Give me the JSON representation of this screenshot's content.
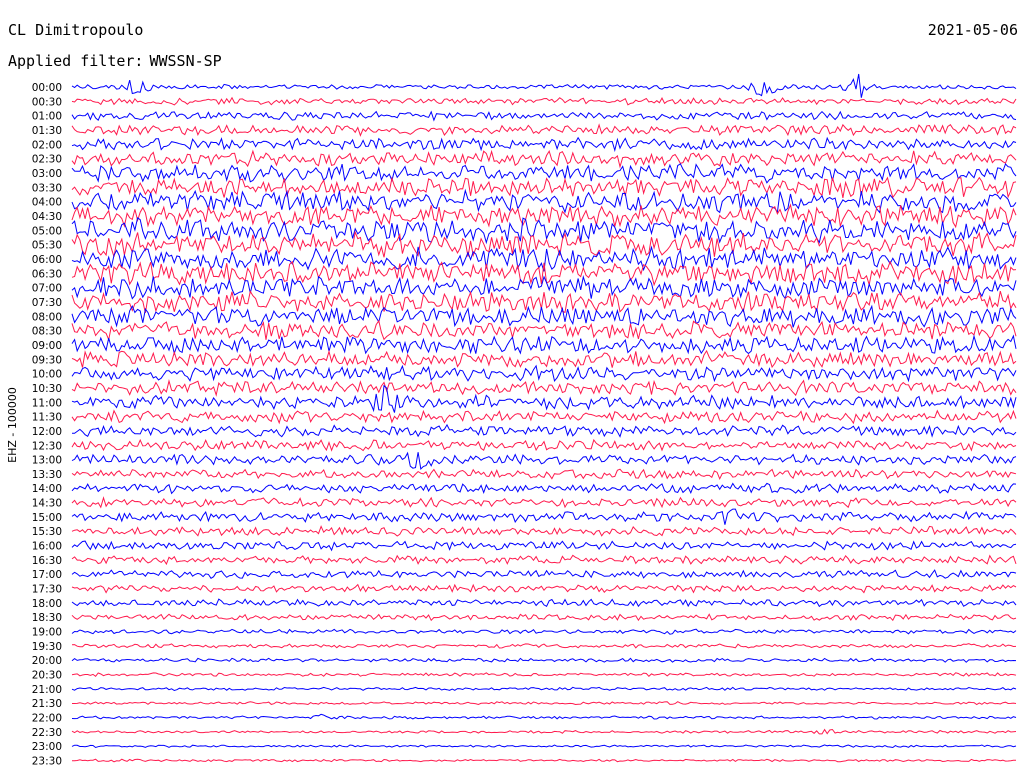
{
  "header": {
    "station": "CL Dimitropoulo",
    "filter_label": "Applied filter:",
    "filter_value": "WWSSN-SP",
    "date": "2021-05-06"
  },
  "chart_data": {
    "type": "line",
    "ylabel": "EHZ - 100000",
    "row_interval_minutes": 30,
    "row_labels": [
      "00:00",
      "00:30",
      "01:00",
      "01:30",
      "02:00",
      "02:30",
      "03:00",
      "03:30",
      "04:00",
      "04:30",
      "05:00",
      "05:30",
      "06:00",
      "06:30",
      "07:00",
      "07:30",
      "08:00",
      "08:30",
      "09:00",
      "09:30",
      "10:00",
      "10:30",
      "11:00",
      "11:30",
      "12:00",
      "12:30",
      "13:00",
      "13:30",
      "14:00",
      "14:30",
      "15:00",
      "15:30",
      "16:00",
      "16:30",
      "17:00",
      "17:30",
      "18:00",
      "18:30",
      "19:00",
      "19:30",
      "20:00",
      "20:30",
      "21:00",
      "21:30",
      "22:00",
      "22:30",
      "23:00",
      "23:30"
    ],
    "trace_colors": [
      "#0000ff",
      "#ff1a4d"
    ],
    "activity_level": [
      0.25,
      0.35,
      0.45,
      0.55,
      0.65,
      0.8,
      0.95,
      1.05,
      1.15,
      1.2,
      1.25,
      1.25,
      1.2,
      1.2,
      1.15,
      1.15,
      1.1,
      1.0,
      0.95,
      0.85,
      0.8,
      0.75,
      0.7,
      0.65,
      0.6,
      0.55,
      0.55,
      0.5,
      0.5,
      0.5,
      0.5,
      0.48,
      0.45,
      0.45,
      0.42,
      0.4,
      0.38,
      0.32,
      0.25,
      0.22,
      0.2,
      0.18,
      0.16,
      0.15,
      0.15,
      0.14,
      0.13,
      0.13
    ],
    "events": [
      {
        "row": 0,
        "minute": 2,
        "amplitude": 6
      },
      {
        "row": 0,
        "minute": 22,
        "amplitude": 8
      },
      {
        "row": 0,
        "minute": 25,
        "amplitude": 6
      },
      {
        "row": 22,
        "minute": 10,
        "amplitude": 2.5
      },
      {
        "row": 26,
        "minute": 11,
        "amplitude": 2
      },
      {
        "row": 30,
        "minute": 21,
        "amplitude": 2
      },
      {
        "row": 44,
        "minute": 8,
        "amplitude": 2
      },
      {
        "row": 45,
        "minute": 24,
        "amplitude": 1.5
      }
    ]
  }
}
